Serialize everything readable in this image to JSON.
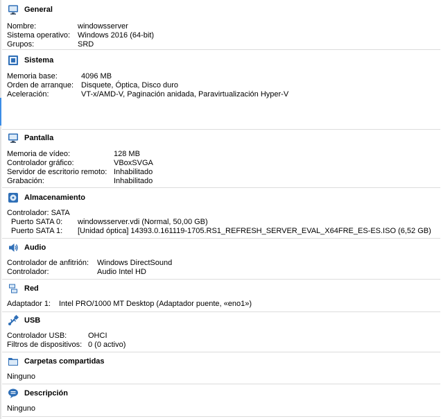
{
  "general": {
    "title": "General",
    "rows": [
      {
        "label": "Nombre:",
        "value": "windowsserver"
      },
      {
        "label": "Sistema operativo:",
        "value": "Windows 2016 (64-bit)"
      },
      {
        "label": "Grupos:",
        "value": "SRD"
      }
    ]
  },
  "sistema": {
    "title": "Sistema",
    "rows": [
      {
        "label": "Memoria base:",
        "value": "4096 MB"
      },
      {
        "label": "Orden de arranque:",
        "value": "Disquete, Óptica, Disco duro"
      },
      {
        "label": "Aceleración:",
        "value": "VT-x/AMD-V, Paginación anidada, Paravirtualización Hyper-V"
      }
    ]
  },
  "pantalla": {
    "title": "Pantalla",
    "rows": [
      {
        "label": "Memoria de vídeo:",
        "value": "128 MB"
      },
      {
        "label": "Controlador gráfico:",
        "value": "VBoxSVGA"
      },
      {
        "label": "Servidor de escritorio remoto:",
        "value": "Inhabilitado"
      },
      {
        "label": "Grabación:",
        "value": "Inhabilitado"
      }
    ]
  },
  "almacenamiento": {
    "title": "Almacenamiento",
    "controller": "Controlador: SATA",
    "rows": [
      {
        "label": "Puerto SATA 0:",
        "value": "windowsserver.vdi (Normal, 50,00 GB)"
      },
      {
        "label": "Puerto SATA 1:",
        "value": "[Unidad óptica]  14393.0.161119-1705.RS1_REFRESH_SERVER_EVAL_X64FRE_ES-ES.ISO (6,52 GB)"
      }
    ]
  },
  "audio": {
    "title": "Audio",
    "rows": [
      {
        "label": "Controlador de anfitrión:",
        "value": "Windows DirectSound"
      },
      {
        "label": "Controlador:",
        "value": "Audio Intel HD"
      }
    ]
  },
  "red": {
    "title": "Red",
    "rows": [
      {
        "label": "Adaptador 1:",
        "value": "Intel PRO/1000 MT Desktop (Adaptador puente, «eno1»)"
      }
    ]
  },
  "usb": {
    "title": "USB",
    "rows": [
      {
        "label": "Controlador USB:",
        "value": "OHCI"
      },
      {
        "label": "Filtros de dispositivos:",
        "value": "0 (0 activo)"
      }
    ]
  },
  "carpetas": {
    "title": "Carpetas compartidas",
    "text": "Ninguno"
  },
  "descripcion": {
    "title": "Descripción",
    "text": "Ninguno"
  }
}
